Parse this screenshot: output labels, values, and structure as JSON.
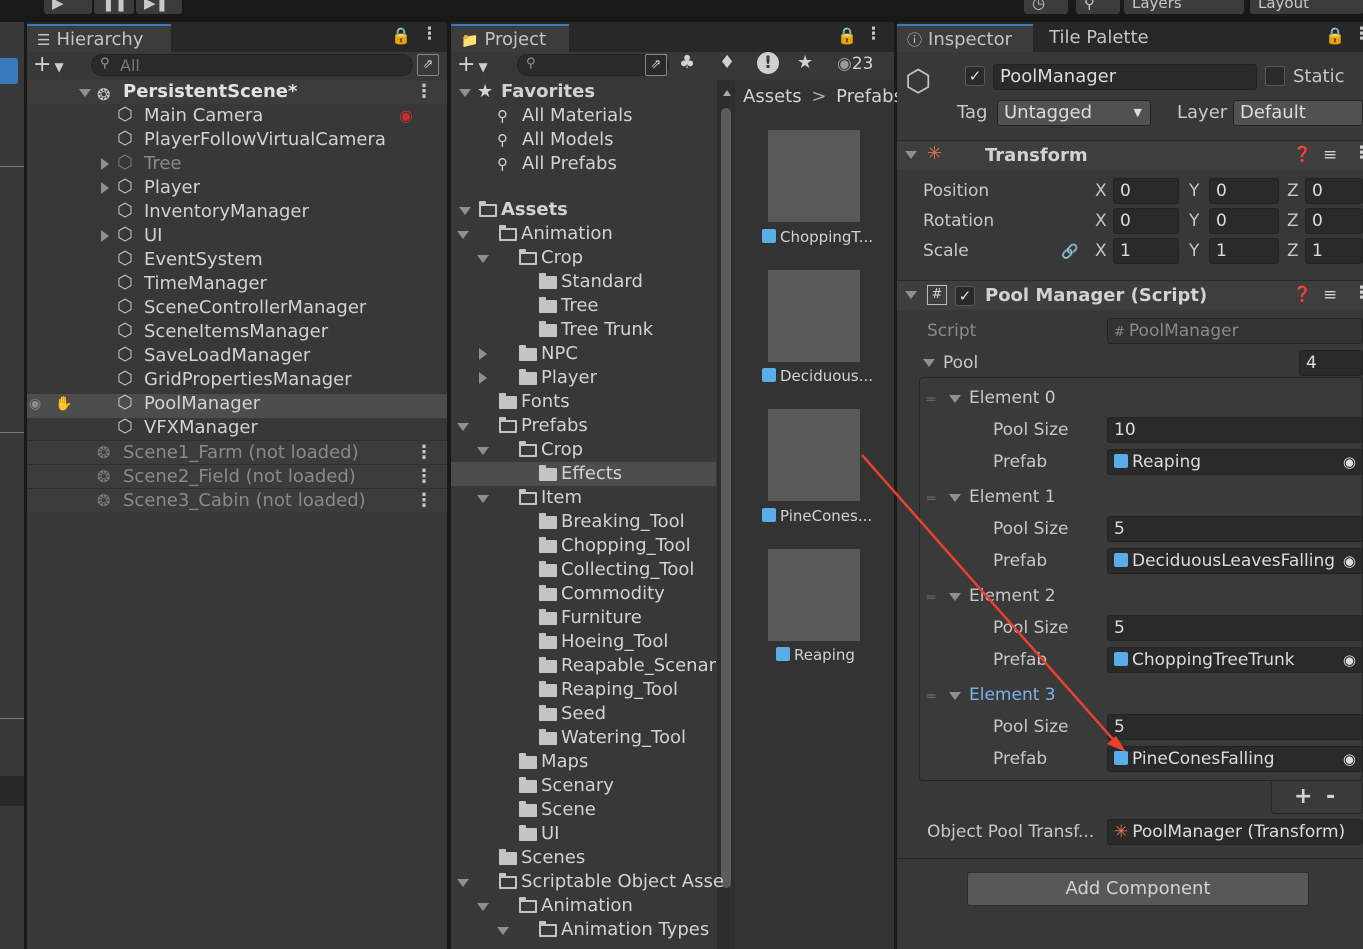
{
  "toolbar": {
    "layers_label": "Layers",
    "layout_label": "Layout"
  },
  "hierarchy": {
    "tab": "Hierarchy",
    "search_placeholder": "All",
    "scene_name": "PersistentScene*",
    "items": [
      {
        "label": "Main Camera"
      },
      {
        "label": "PlayerFollowVirtualCamera"
      },
      {
        "label": "Tree"
      },
      {
        "label": "Player"
      },
      {
        "label": "InventoryManager"
      },
      {
        "label": "UI"
      },
      {
        "label": "EventSystem"
      },
      {
        "label": "TimeManager"
      },
      {
        "label": "SceneControllerManager"
      },
      {
        "label": "SceneItemsManager"
      },
      {
        "label": "SaveLoadManager"
      },
      {
        "label": "GridPropertiesManager"
      },
      {
        "label": "PoolManager"
      },
      {
        "label": "VFXManager"
      }
    ],
    "unloaded_scenes": [
      {
        "label": "Scene1_Farm (not loaded)"
      },
      {
        "label": "Scene2_Field (not loaded)"
      },
      {
        "label": "Scene3_Cabin (not loaded)"
      }
    ]
  },
  "project": {
    "tab": "Project",
    "hidden_count": "23",
    "favorites_label": "Favorites",
    "favorites": [
      "All Materials",
      "All Models",
      "All Prefabs"
    ],
    "assets_label": "Assets",
    "tree": [
      "Animation",
      "Crop",
      "Standard",
      "Tree",
      "Tree Trunk",
      "NPC",
      "Player",
      "Fonts",
      "Prefabs",
      "Crop",
      "Effects",
      "Item",
      "Breaking_Tool",
      "Chopping_Tool",
      "Collecting_Tool",
      "Commodity",
      "Furniture",
      "Hoeing_Tool",
      "Reapable_Scenar",
      "Reaping_Tool",
      "Seed",
      "Watering_Tool",
      "Maps",
      "Scenary",
      "Scene",
      "UI",
      "Scenes",
      "Scriptable Object Asse",
      "Animation",
      "Animation Types"
    ],
    "breadcrumb": [
      "Assets",
      ">",
      "Prefabs"
    ],
    "assets": [
      "ChoppingT...",
      "Deciduous...",
      "PineCones...",
      "Reaping"
    ]
  },
  "inspector": {
    "tabs": [
      "Inspector",
      "Tile Palette"
    ],
    "object_name": "PoolManager",
    "static_label": "Static",
    "tag_label": "Tag",
    "tag_value": "Untagged",
    "layer_label": "Layer",
    "layer_value": "Default",
    "transform": {
      "title": "Transform",
      "rows": [
        {
          "label": "Position",
          "x": "0",
          "y": "0",
          "z": "0"
        },
        {
          "label": "Rotation",
          "x": "0",
          "y": "0",
          "z": "0"
        },
        {
          "label": "Scale",
          "x": "1",
          "y": "1",
          "z": "1"
        }
      ],
      "axis_x": "X",
      "axis_y": "Y",
      "axis_z": "Z"
    },
    "pool_script": {
      "title": "Pool Manager (Script)",
      "script_label": "Script",
      "script_value": "PoolManager",
      "pool_label": "Pool",
      "pool_count": "4",
      "pool_size_label": "Pool Size",
      "prefab_label": "Prefab",
      "elements": [
        {
          "label": "Element 0",
          "size": "10",
          "prefab": "Reaping"
        },
        {
          "label": "Element 1",
          "size": "5",
          "prefab": "DeciduousLeavesFalling"
        },
        {
          "label": "Element 2",
          "size": "5",
          "prefab": "ChoppingTreeTrunk"
        },
        {
          "label": "Element 3",
          "size": "5",
          "prefab": "PineConesFalling"
        }
      ],
      "add_label": "+",
      "remove_label": "-",
      "transform_label": "Object Pool Transf...",
      "transform_value": "PoolManager (Transform)"
    },
    "add_component_label": "Add Component"
  },
  "colors": {
    "accent": "#3a79bb",
    "annotation_arrow": "#e8412c",
    "highlight_text": "#7fb1ec"
  }
}
